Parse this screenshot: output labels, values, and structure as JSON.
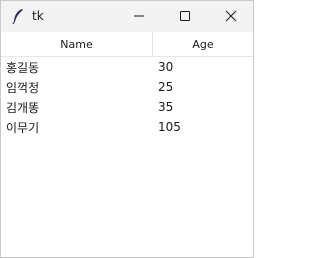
{
  "window": {
    "title": "tk"
  },
  "table": {
    "columns": [
      "Name",
      "Age"
    ],
    "rows": [
      {
        "name": "홍길동",
        "age": "30"
      },
      {
        "name": "임꺽정",
        "age": "25"
      },
      {
        "name": "김개똥",
        "age": "35"
      },
      {
        "name": "이무기",
        "age": "105"
      }
    ]
  },
  "icons": {
    "app": "feather-icon",
    "minimize": "minimize-icon",
    "maximize": "maximize-icon",
    "close": "close-icon"
  }
}
